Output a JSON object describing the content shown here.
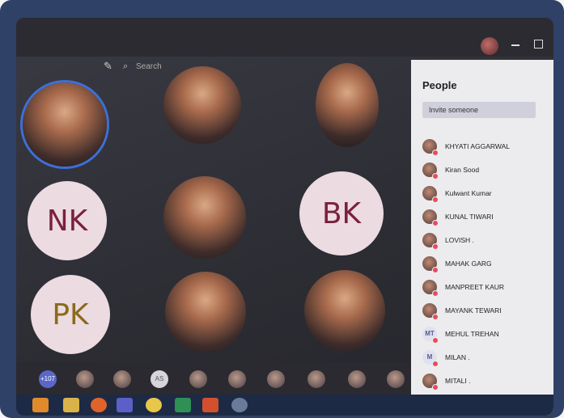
{
  "search": {
    "label": "Search"
  },
  "tiles": [
    {
      "initials": ""
    },
    {
      "initials": "NK",
      "color": "#7a2040"
    },
    {
      "initials": "BK",
      "color": "#7a2040"
    },
    {
      "initials": "PK",
      "color": "#8a6a1c"
    }
  ],
  "people": {
    "title": "People",
    "invite_label": "Invite someone",
    "members": [
      {
        "name": "KHYATI AGGARWAL"
      },
      {
        "name": "Kiran Sood"
      },
      {
        "name": "Kulwant Kumar"
      },
      {
        "name": "KUNAL TIWARI"
      },
      {
        "name": "LOVISH ."
      },
      {
        "name": "MAHAK GARG"
      },
      {
        "name": "MANPREET KAUR"
      },
      {
        "name": "MAYANK TEWARI"
      },
      {
        "name": "MEHUL TREHAN",
        "initials": "MT"
      },
      {
        "name": "MILAN .",
        "initials": "M"
      },
      {
        "name": "MITALI ."
      }
    ]
  },
  "roster": {
    "overflow_count": "+107",
    "as_initials": "AS"
  },
  "colors": {
    "accent": "#3d6fd8",
    "status_dot": "#e74c5b",
    "panel": "#ececee"
  }
}
